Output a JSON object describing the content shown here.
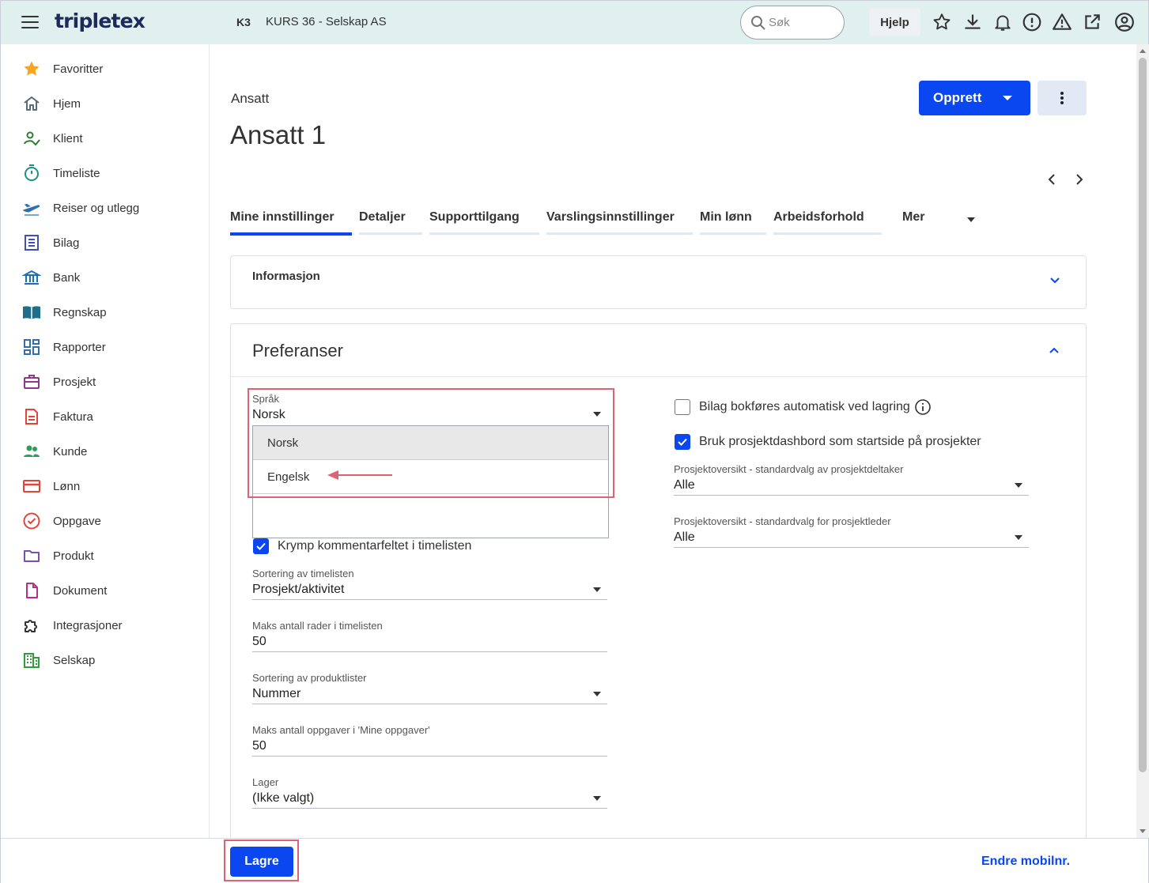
{
  "header": {
    "logo": "tripletex",
    "company_code": "K3",
    "company_name": "KURS 36 - Selskap AS",
    "search_placeholder": "Søk",
    "help_label": "Hjelp",
    "icons": [
      "star-icon",
      "download-icon",
      "bell-icon",
      "alert-circle-icon",
      "warning-icon",
      "external-link-icon",
      "account-icon"
    ]
  },
  "sidebar": {
    "items": [
      {
        "label": "Favoritter",
        "icon": "star-icon",
        "color": "#f5a623"
      },
      {
        "label": "Hjem",
        "icon": "home-icon",
        "color": "#5a6b7a"
      },
      {
        "label": "Klient",
        "icon": "client-icon",
        "color": "#2e7d32"
      },
      {
        "label": "Timeliste",
        "icon": "timer-icon",
        "color": "#1f8f8a"
      },
      {
        "label": "Reiser og utlegg",
        "icon": "plane-icon",
        "color": "#2f6fb0"
      },
      {
        "label": "Bilag",
        "icon": "voucher-icon",
        "color": "#3f51b5"
      },
      {
        "label": "Bank",
        "icon": "bank-icon",
        "color": "#1f6fb0"
      },
      {
        "label": "Regnskap",
        "icon": "book-icon",
        "color": "#1f6f8a"
      },
      {
        "label": "Rapporter",
        "icon": "dashboard-icon",
        "color": "#2f6fb0"
      },
      {
        "label": "Prosjekt",
        "icon": "briefcase-icon",
        "color": "#8e3a8a"
      },
      {
        "label": "Faktura",
        "icon": "invoice-icon",
        "color": "#e0453a"
      },
      {
        "label": "Kunde",
        "icon": "people-icon",
        "color": "#2e9d5a"
      },
      {
        "label": "Lønn",
        "icon": "card-icon",
        "color": "#e0453a"
      },
      {
        "label": "Oppgave",
        "icon": "check-circle-icon",
        "color": "#e0453a"
      },
      {
        "label": "Produkt",
        "icon": "folder-icon",
        "color": "#7a4fb0"
      },
      {
        "label": "Dokument",
        "icon": "document-icon",
        "color": "#b0308a"
      },
      {
        "label": "Integrasjoner",
        "icon": "puzzle-icon",
        "color": "#333333"
      },
      {
        "label": "Selskap",
        "icon": "building-icon",
        "color": "#2e9d3a"
      }
    ]
  },
  "page": {
    "breadcrumb": "Ansatt",
    "title": "Ansatt 1",
    "create_label": "Opprett",
    "tabs": [
      {
        "label": "Mine innstillinger",
        "active": true
      },
      {
        "label": "Detaljer",
        "active": false
      },
      {
        "label": "Supporttilgang",
        "active": false
      },
      {
        "label": "Varslingsinnstillinger",
        "active": false
      },
      {
        "label": "Min lønn",
        "active": false
      },
      {
        "label": "Arbeidsforhold",
        "active": false
      },
      {
        "label": "Mer",
        "active": false
      }
    ]
  },
  "info_card": {
    "title": "Informasjon"
  },
  "prefs": {
    "title": "Preferanser",
    "language": {
      "label": "Språk",
      "value": "Norsk",
      "options": [
        {
          "label": "Norsk",
          "selected": true
        },
        {
          "label": "Engelsk",
          "selected": false
        }
      ]
    },
    "shrink_comment": {
      "label": "Krymp kommentarfeltet i timelisten",
      "checked": true
    },
    "timesheet_sort": {
      "label": "Sortering av timelisten",
      "value": "Prosjekt/aktivitet"
    },
    "max_rows": {
      "label": "Maks antall rader i timelisten",
      "value": "50"
    },
    "product_sort": {
      "label": "Sortering av produktlister",
      "value": "Nummer"
    },
    "max_tasks": {
      "label": "Maks antall oppgaver i 'Mine oppgaver'",
      "value": "50"
    },
    "warehouse": {
      "label": "Lager",
      "value": "(Ikke valgt)"
    },
    "auto_post": {
      "label": "Bilag bokføres automatisk ved lagring",
      "checked": false
    },
    "project_dashboard": {
      "label": "Bruk prosjektdashbord som startside på prosjekter",
      "checked": true
    },
    "participant_default": {
      "label": "Prosjektoversikt - standardvalg av prosjektdeltaker",
      "value": "Alle"
    },
    "leader_default": {
      "label": "Prosjektoversikt - standardvalg for prosjektleder",
      "value": "Alle"
    }
  },
  "footer": {
    "save_label": "Lagre",
    "mobile_link": "Endre mobilnr."
  },
  "colors": {
    "primary": "#0b47f0",
    "header_bg": "#dff0ef",
    "annotation": "#e06272"
  }
}
